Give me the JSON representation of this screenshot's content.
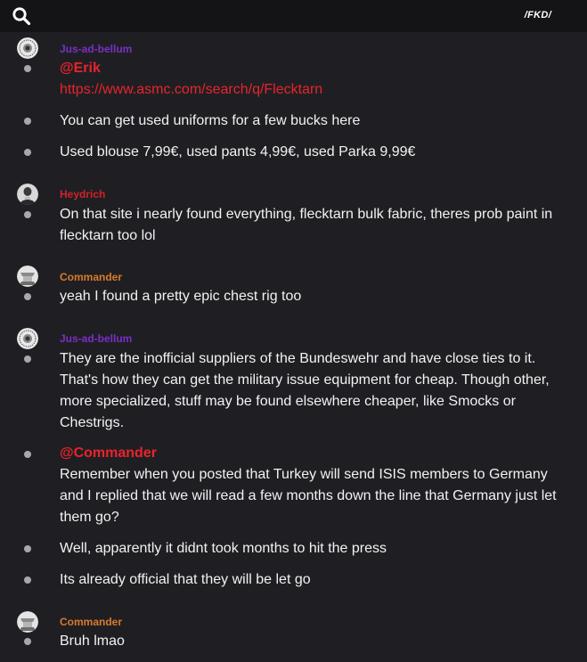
{
  "header": {
    "brand": "/FKD/",
    "search_icon": "search-icon"
  },
  "colors": {
    "background": "#1f1f23",
    "topbar": "#141416",
    "mention": "#e8242c",
    "user_jus": "#7b2ec4",
    "user_heydrich": "#d3202a",
    "user_commander": "#d97a2b",
    "bullet": "#a8a8ac"
  },
  "messages": [
    {
      "user": "Jus-ad-bellum",
      "mention": "@Erik",
      "link": "https://www.asmc.com/search/q/Flecktarn",
      "lines": [
        "You can get used uniforms for a few bucks here",
        "Used blouse 7,99€, used pants 4,99€, used Parka 9,99€"
      ]
    },
    {
      "user": "Heydrich",
      "lines": [
        "On that site i nearly found everything, flecktarn bulk fabric, theres prob paint in flecktarn too lol"
      ]
    },
    {
      "user": "Commander",
      "lines": [
        "yeah I found a pretty epic chest rig too"
      ]
    },
    {
      "user": "Jus-ad-bellum",
      "lines": [
        "They are the inofficial suppliers of the Bundeswehr and have close ties to it. That's how they can get the military issue equipment for cheap. Though other, more specialized, stuff may be found elsewhere cheaper, like Smocks or Chestrigs."
      ],
      "mention": "@Commander",
      "lines2": [
        "Remember when you posted that Turkey will send ISIS members to Germany and I replied that we will read a few months down the line that Germany just let them go?",
        "Well, apparently it didnt took months to hit the press",
        "Its already official that they will be let go"
      ]
    },
    {
      "user": "Commander",
      "lines": [
        "Bruh lmao"
      ]
    }
  ]
}
